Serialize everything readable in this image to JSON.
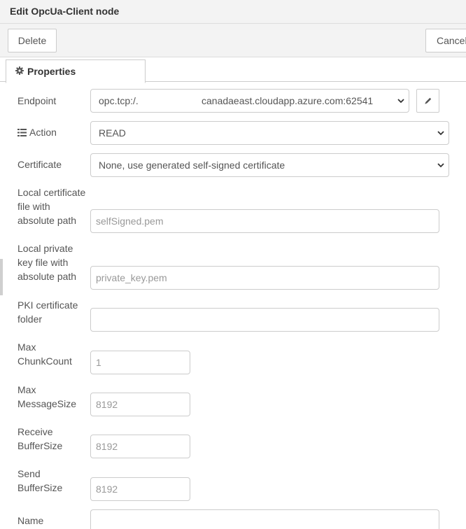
{
  "dialog": {
    "title": "Edit OpcUa-Client node",
    "delete_label": "Delete",
    "cancel_label": "Cancel"
  },
  "tab": {
    "label": "Properties",
    "icon": "gear-icon"
  },
  "fields": {
    "endpoint": {
      "label": "Endpoint",
      "value_prefix": "opc.tcp:/.",
      "value_host": "canadaeast.cloudapp.azure.com:62541",
      "edit_icon": "pencil-icon"
    },
    "action": {
      "label": "Action",
      "icon": "list-icon",
      "value": "READ"
    },
    "certificate": {
      "label": "Certificate",
      "value": "None, use generated self-signed certificate"
    },
    "local_cert": {
      "label_lines": [
        "Local certificate",
        "file with",
        "absolute path"
      ],
      "placeholder": "selfSigned.pem"
    },
    "local_key": {
      "label_lines": [
        "Local private",
        "key file with",
        "absolute path"
      ],
      "placeholder": "private_key.pem"
    },
    "pki_folder": {
      "label_lines": [
        "PKI certificate",
        "folder"
      ],
      "value": ""
    },
    "max_chunk": {
      "label_lines": [
        "Max",
        "ChunkCount"
      ],
      "placeholder": "1"
    },
    "max_message": {
      "label_lines": [
        "Max",
        "MessageSize"
      ],
      "placeholder": "8192"
    },
    "receive_buffer": {
      "label_lines": [
        "Receive",
        "BufferSize"
      ],
      "placeholder": "8192"
    },
    "send_buffer": {
      "label_lines": [
        "Send",
        "BufferSize"
      ],
      "placeholder": "8192"
    },
    "name": {
      "label": "Name",
      "value": ""
    }
  }
}
